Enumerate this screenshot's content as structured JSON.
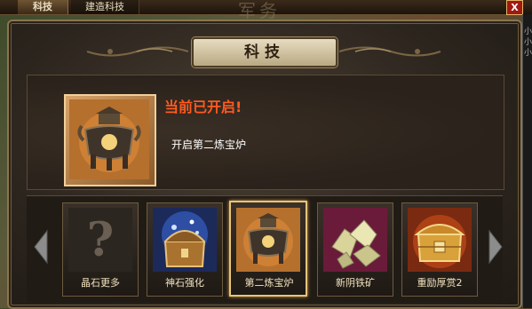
{
  "top_bar": {
    "tabs": [
      {
        "label": "科技",
        "active": true
      },
      {
        "label": "建造科技",
        "active": false
      }
    ],
    "background_text": "军务",
    "close_label": "X"
  },
  "right_edge": {
    "chars": [
      "小",
      "小",
      "小"
    ]
  },
  "panel": {
    "title": "科技",
    "current": {
      "icon": "cauldron-icon",
      "headline": "当前已开启!",
      "description": "开启第二炼宝炉"
    },
    "slots": [
      {
        "label": "晶石更多",
        "icon": "question-mark-icon",
        "selected": false
      },
      {
        "label": "神石强化",
        "icon": "treasure-chest-icon",
        "selected": false
      },
      {
        "label": "第二炼宝炉",
        "icon": "cauldron-icon",
        "selected": true
      },
      {
        "label": "新阴铁矿",
        "icon": "ore-crystals-icon",
        "selected": false
      },
      {
        "label": "重励厚赏2",
        "icon": "gold-box-icon",
        "selected": false
      }
    ]
  },
  "colors": {
    "headline": "#ff5a1f",
    "frame_gold": "#8b7550",
    "close_red": "#a21812"
  }
}
